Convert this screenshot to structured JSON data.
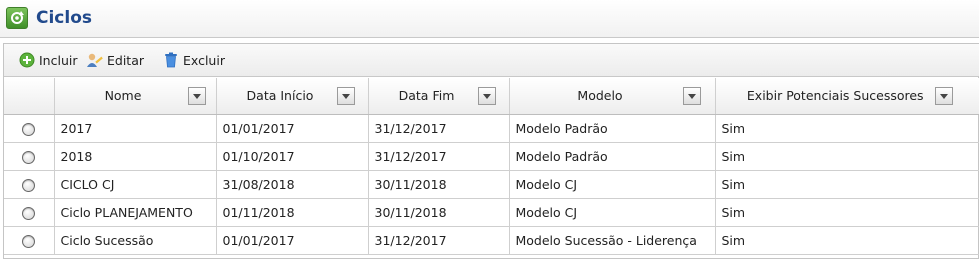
{
  "page": {
    "title": "Ciclos"
  },
  "toolbar": {
    "incluir_label": "Incluir",
    "editar_label": "Editar",
    "excluir_label": "Excluir"
  },
  "grid": {
    "columns": [
      "Nome",
      "Data Início",
      "Data Fim",
      "Modelo",
      "Exibir Potenciais Sucessores"
    ],
    "rows": [
      {
        "nome": "2017",
        "data_inicio": "01/01/2017",
        "data_fim": "31/12/2017",
        "modelo": "Modelo Padrão",
        "exibir": "Sim"
      },
      {
        "nome": "2018",
        "data_inicio": "01/10/2017",
        "data_fim": "31/12/2017",
        "modelo": "Modelo Padrão",
        "exibir": "Sim"
      },
      {
        "nome": "CICLO CJ",
        "data_inicio": "31/08/2018",
        "data_fim": "30/11/2018",
        "modelo": "Modelo CJ",
        "exibir": "Sim"
      },
      {
        "nome": "Ciclo PLANEJAMENTO",
        "data_inicio": "01/11/2018",
        "data_fim": "30/11/2018",
        "modelo": "Modelo CJ",
        "exibir": "Sim"
      },
      {
        "nome": "Ciclo Sucessão",
        "data_inicio": "01/01/2017",
        "data_fim": "31/12/2017",
        "modelo": "Modelo Sucessão - Liderença",
        "exibir": "Sim"
      }
    ]
  },
  "icons": {
    "app": "cycle-icon",
    "incluir": "add-icon",
    "editar": "edit-icon",
    "excluir": "trash-icon",
    "filter": "dropdown-filter-icon",
    "row_select": "radio-icon"
  },
  "colors": {
    "title": "#214a8c",
    "accent_green": "#3f8f28",
    "trash_blue": "#3b7fd0"
  }
}
